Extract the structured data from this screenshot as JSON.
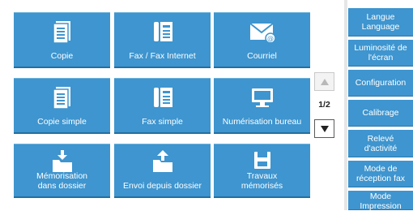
{
  "tiles": [
    {
      "label": "Copie",
      "icon": "copy-icon"
    },
    {
      "label": "Fax / Fax Internet",
      "icon": "fax-icon"
    },
    {
      "label": "Courriel",
      "icon": "email-icon"
    },
    {
      "label": "Copie simple",
      "icon": "copy-icon"
    },
    {
      "label": "Fax simple",
      "icon": "fax-icon"
    },
    {
      "label": "Numérisation bureau",
      "icon": "monitor-icon"
    },
    {
      "label": "Mémorisation\ndans dossier",
      "icon": "folder-download-icon"
    },
    {
      "label": "Envoi depuis dossier",
      "icon": "folder-upload-icon"
    },
    {
      "label": "Travaux\nmémorisés",
      "icon": "save-disk-icon"
    }
  ],
  "pager": {
    "indicator": "1/2"
  },
  "sidebar": {
    "items": [
      {
        "label": "Langue\nLanguage"
      },
      {
        "label": "Luminosité de\nl'écran"
      },
      {
        "label": "Configuration"
      },
      {
        "label": "Calibrage"
      },
      {
        "label": "Relevé\nd'activité"
      },
      {
        "label": "Mode de\nréception fax"
      },
      {
        "label": "Mode\nImpression"
      }
    ]
  },
  "colors": {
    "tile": "#3e95cf",
    "background": "#ffffff"
  }
}
